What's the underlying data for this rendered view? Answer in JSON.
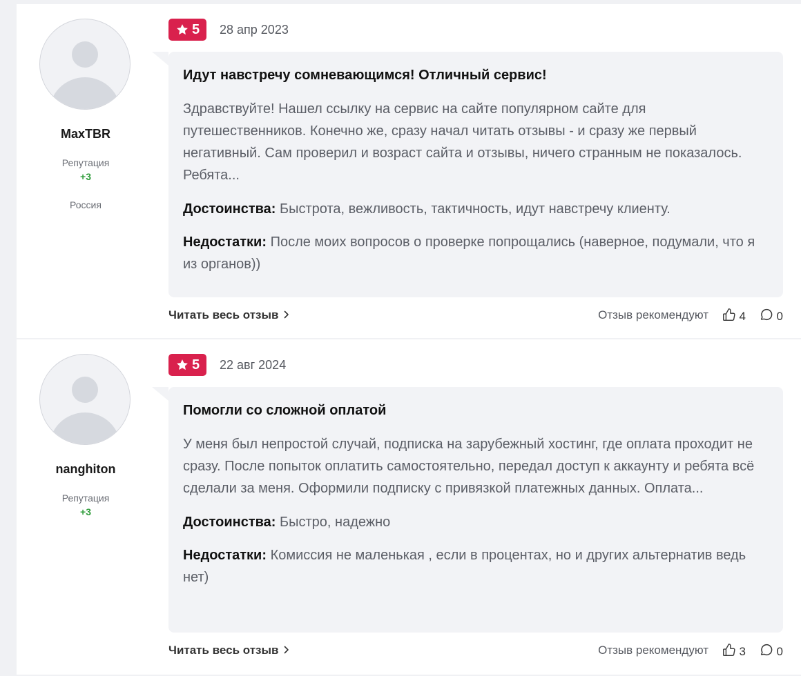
{
  "reviews": [
    {
      "author": {
        "name": "MaxTBR",
        "reputation_label": "Репутация",
        "reputation_value": "+3",
        "country": "Россия"
      },
      "rating": "5",
      "date": "28 апр 2023",
      "title": "Идут навстречу сомневающимся! Отличный сервис!",
      "body": "Здравствуйте! Нашел ссылку на сервис на сайте популярном сайте для путешественников. Конечно же, сразу начал читать отзывы - и сразу же первый негативный. Сам проверил и возраст сайта и отзывы, ничего странным не показалось. Ребята...",
      "pros_label": "Достоинства:",
      "pros": "Быстрота, вежливость, тактичность, идут навстречу клиенту.",
      "cons_label": "Недостатки:",
      "cons": "После моих вопросов о проверке попрощались (наверное, подумали, что я из органов))",
      "read_more": "Читать весь отзыв",
      "recommend_label": "Отзыв рекомендуют",
      "likes": "4",
      "comments": "0"
    },
    {
      "author": {
        "name": "nanghiton",
        "reputation_label": "Репутация",
        "reputation_value": "+3",
        "country": ""
      },
      "rating": "5",
      "date": "22 авг 2024",
      "title": "Помогли со сложной оплатой",
      "body": "У меня был непростой случай, подписка на зарубежный хостинг, где оплата проходит не сразу. После попыток оплатить самостоятельно, передал доступ к аккаунту и ребята всё сделали за меня. Оформили подписку с привязкой платежных данных. Оплата...",
      "pros_label": "Достоинства:",
      "pros": "Быстро, надежно",
      "cons_label": "Недостатки:",
      "cons": "Комиссия не маленькая , если в процентах, но и других альтернатив ведь нет)",
      "read_more": "Читать весь отзыв",
      "recommend_label": "Отзыв рекомендуют",
      "likes": "3",
      "comments": "0"
    }
  ],
  "colors": {
    "badge": "#d9214d",
    "reputation": "#2e9c3a",
    "bubble": "#f2f3f6",
    "background": "#f0f1f4"
  },
  "icons": [
    "star-icon",
    "chevron-right-icon",
    "thumbs-up-icon",
    "comment-icon",
    "avatar-placeholder"
  ]
}
